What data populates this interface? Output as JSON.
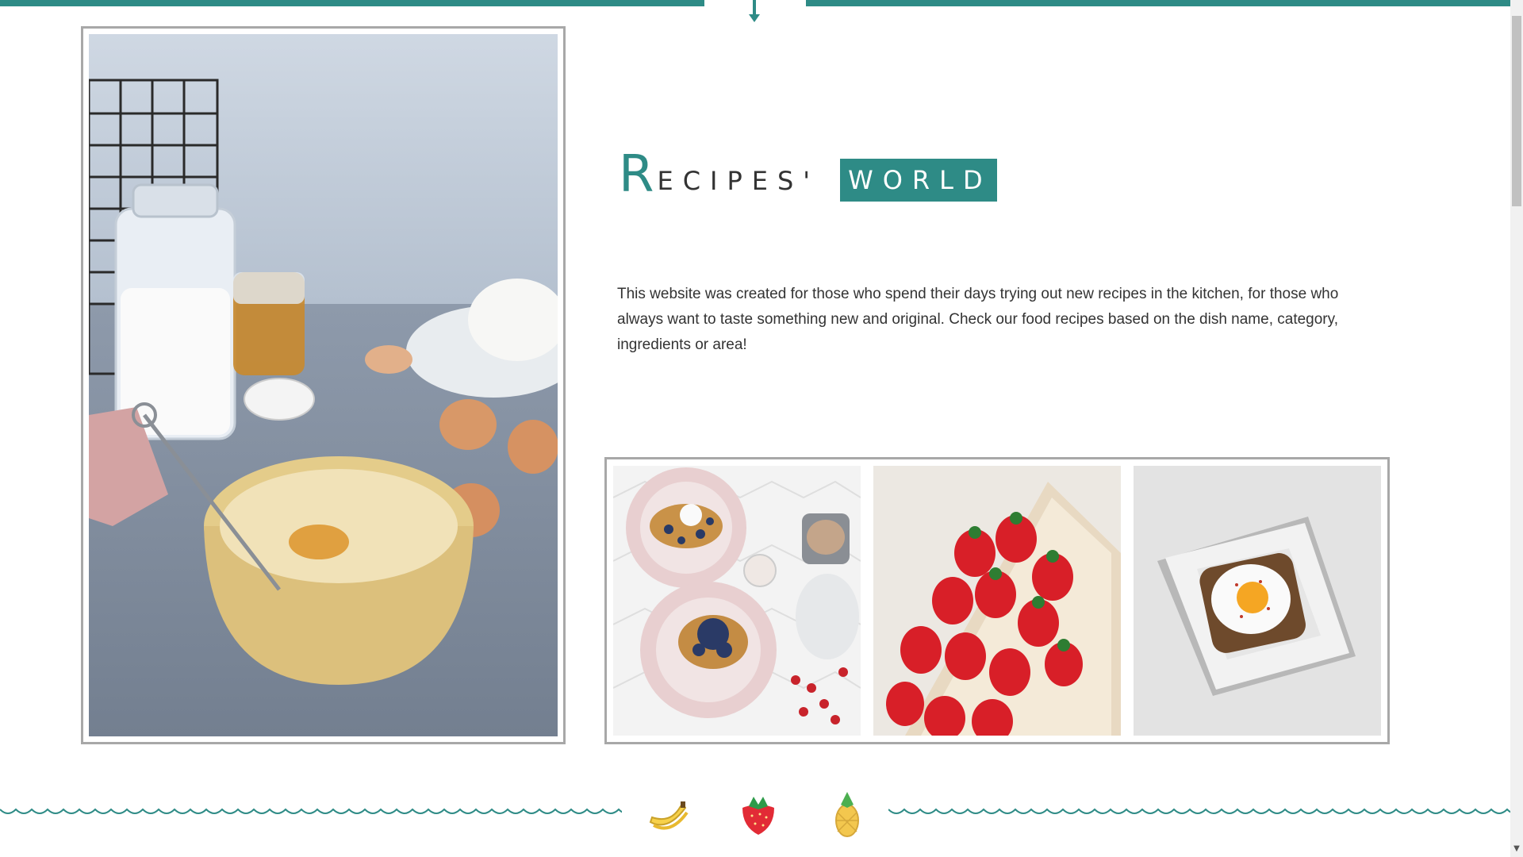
{
  "header": {
    "title_first_letter": "R",
    "title_rest": "ECIPES'",
    "title_badge": "WORLD"
  },
  "intro": {
    "description": "This website was created for those who spend their days trying out new recipes in the kitchen, for those who always want to taste something new and original. Check our food recipes based on the dish name, category, ingredients or area!"
  },
  "images": {
    "hero": "baking-ingredients-photo",
    "gallery": [
      "waffles-photo",
      "strawberries-photo",
      "egg-toast-photo"
    ]
  },
  "decor": {
    "fruits": [
      "banana-icon",
      "strawberry-icon",
      "pineapple-icon"
    ]
  },
  "colors": {
    "accent": "#2e8b86",
    "frame": "#a8a8a8",
    "text": "#333333"
  }
}
